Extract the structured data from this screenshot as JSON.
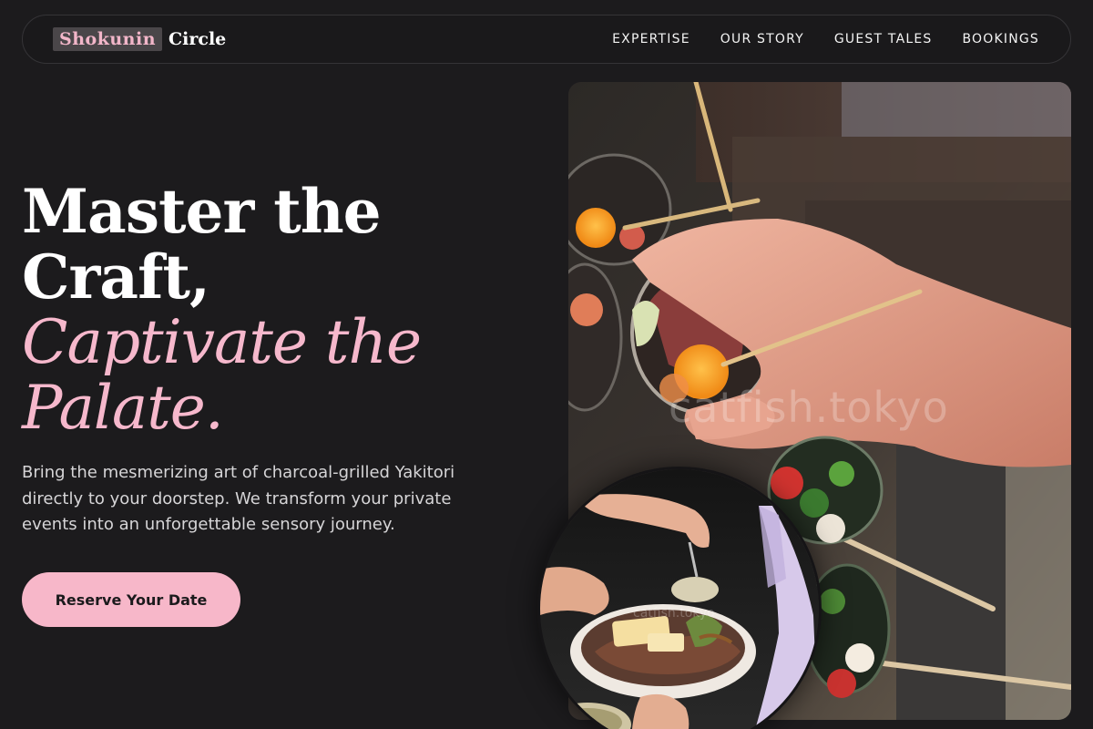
{
  "brand": {
    "badge": "Shokunin",
    "rest": "Circle"
  },
  "nav": {
    "links": [
      "EXPERTISE",
      "OUR STORY",
      "GUEST TALES",
      "BOOKINGS"
    ]
  },
  "hero": {
    "line1": "Master the",
    "line2": "Craft,",
    "accent1": "Captivate the",
    "accent2": "Palate.",
    "description": "Bring the mesmerizing art of charcoal-grilled Yakitori directly to your doorstep. We transform your private events into an unforgettable sensory journey.",
    "cta": "Reserve Your Date"
  },
  "images": {
    "main_watermark": "catfish.tokyo",
    "circle_watermark": "catfish.tokyo"
  },
  "colors": {
    "background": "#1c1b1d",
    "accent_pink": "#f6b8cc",
    "cta_bg": "#f7b7c9",
    "text": "#ffffff"
  }
}
